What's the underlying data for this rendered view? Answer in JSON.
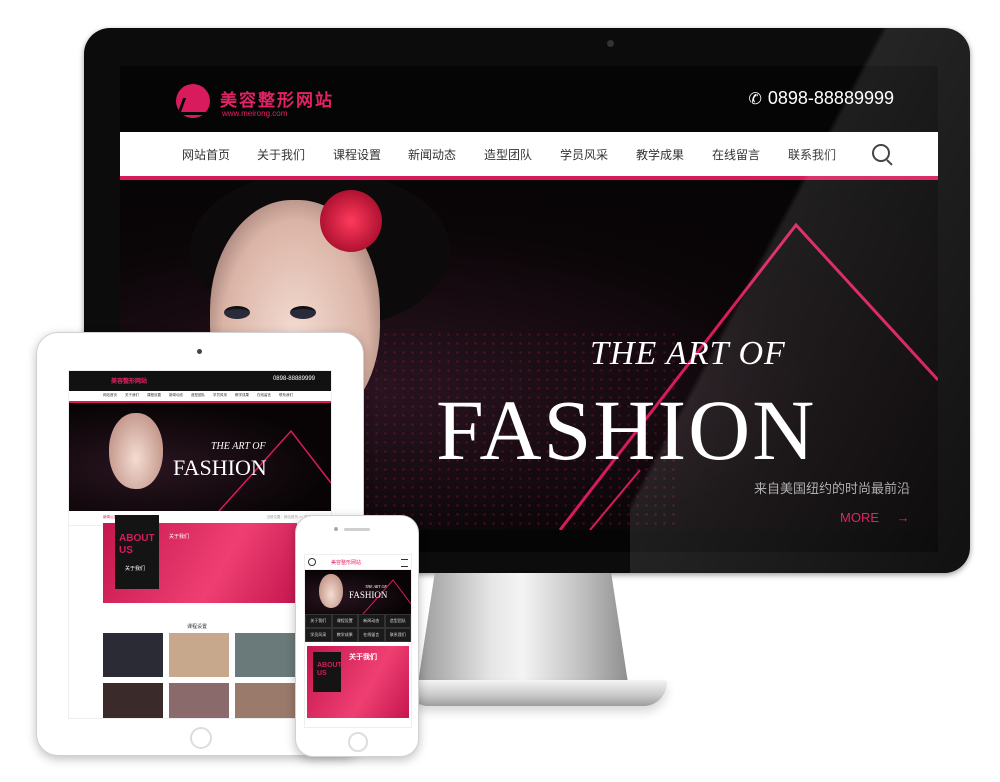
{
  "site": {
    "logo_text": "美容整形网站",
    "logo_url": "www.meirong.com",
    "phone": "0898-88889999"
  },
  "nav": {
    "items": [
      "网站首页",
      "关于我们",
      "课程设置",
      "新闻动态",
      "造型团队",
      "学员风采",
      "教学成果",
      "在线留言",
      "联系我们"
    ]
  },
  "hero": {
    "line1": "THE ART OF",
    "line2": "FASHION",
    "subtitle": "来自美国纽约的时尚最前沿",
    "more": "MORE"
  },
  "tablet": {
    "crumb_left": "新闻公告:",
    "crumb_right": "当前位置：网站首页 >> 关于我们 >>",
    "about_en": "ABOUT US",
    "about_cn": "关于我们",
    "about_title": "关于我们",
    "course_title": "课程设置"
  },
  "mobile": {
    "logo_text": "美容整形网站",
    "grid": [
      "关于我们",
      "课程设置",
      "新闻动态",
      "造型团队",
      "学员风采",
      "教学成果",
      "在线留言",
      "联系我们"
    ],
    "about_en": "ABOUT US",
    "about_title": "关于我们"
  },
  "colors": {
    "accent": "#d81b5d",
    "header_bg": "#050505",
    "nav_bg": "#ffffff"
  },
  "icons": {
    "phone": "phone-icon",
    "search": "search-icon",
    "arrow": "arrow-right-icon",
    "menu": "menu-icon"
  }
}
